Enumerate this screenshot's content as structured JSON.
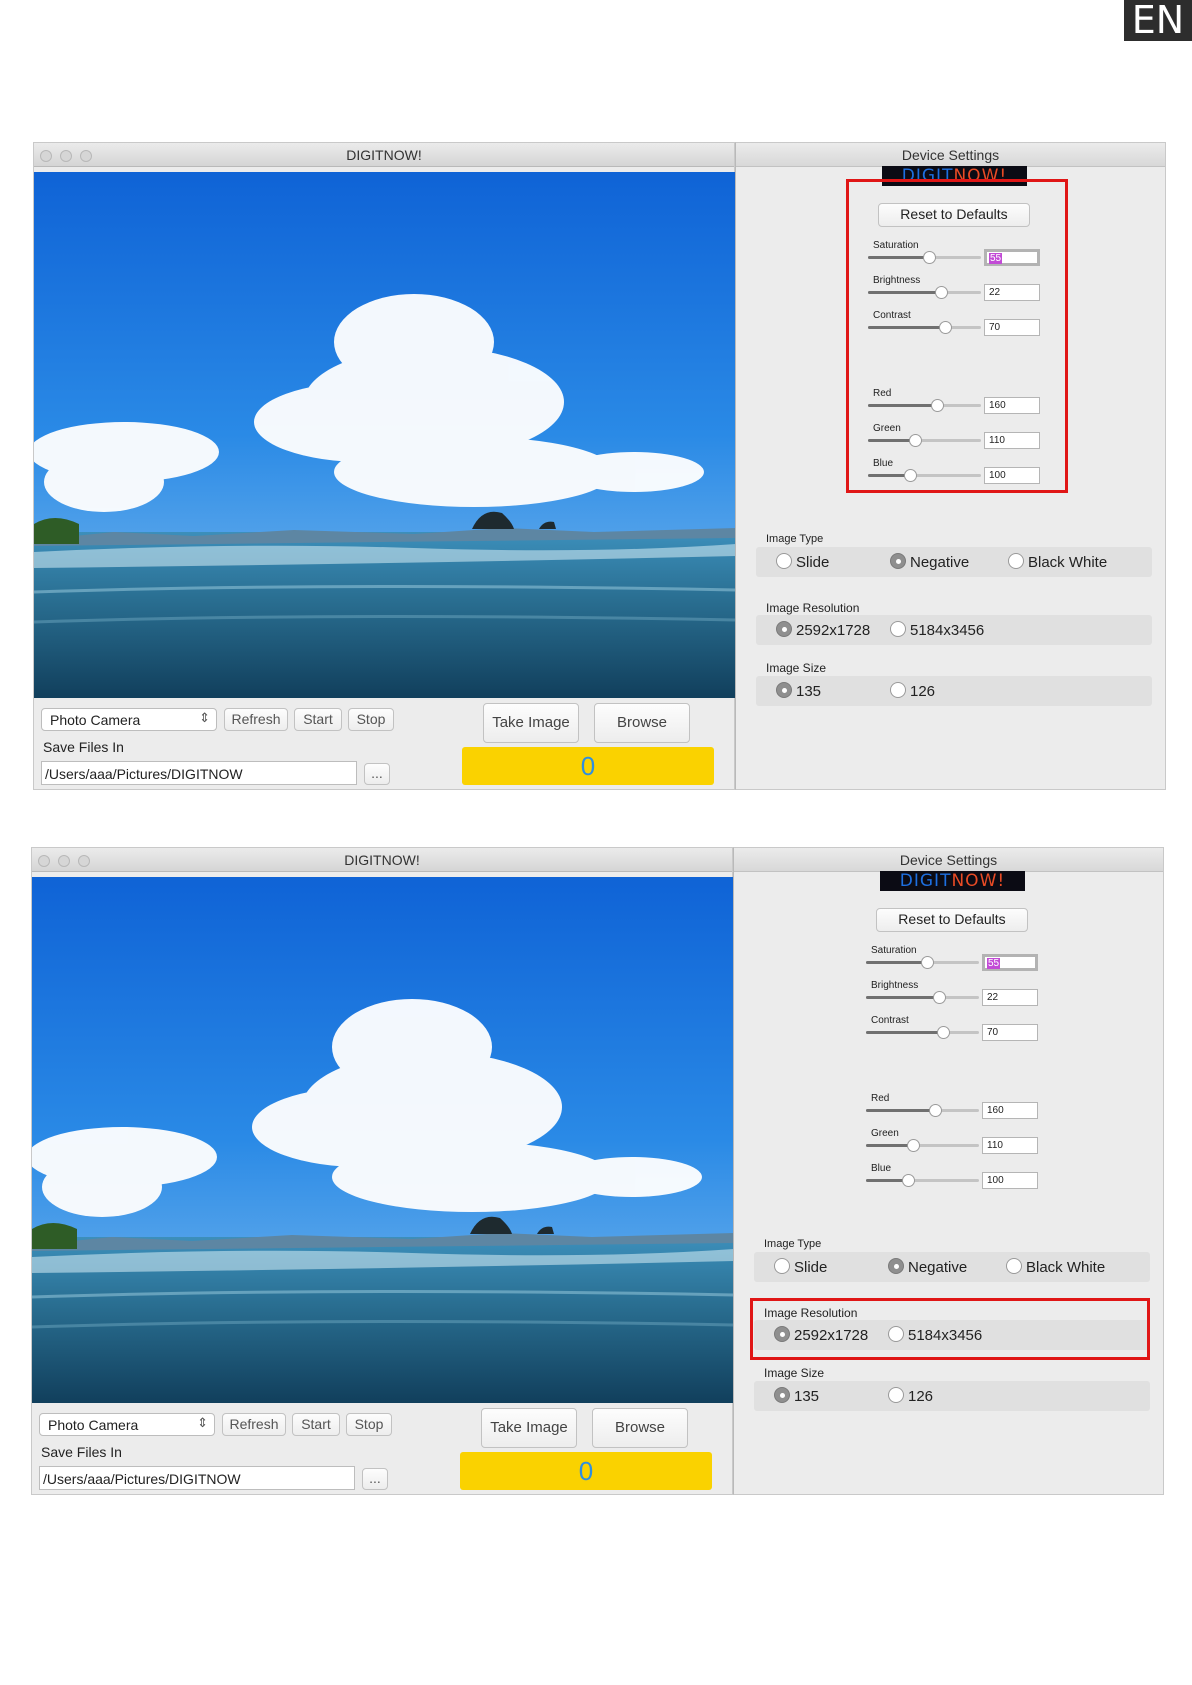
{
  "lang_badge": "EN",
  "window": {
    "title": "DIGITNOW!",
    "source_select": "Photo Camera",
    "buttons": {
      "refresh": "Refresh",
      "start": "Start",
      "stop": "Stop",
      "take_image": "Take Image",
      "browse": "Browse",
      "dots": "..."
    },
    "save_label": "Save Files In",
    "save_path": "/Users/aaa/Pictures/DIGITNOW",
    "counter": "0"
  },
  "settings": {
    "title": "Device Settings",
    "logo_part1": "DIGIT",
    "logo_part2": "NOW!",
    "reset_label": "Reset to Defaults",
    "sliders": [
      {
        "label": "Saturation",
        "value": "55",
        "fraction": 0.54
      },
      {
        "label": "Brightness",
        "value": "22",
        "fraction": 0.65
      },
      {
        "label": "Contrast",
        "value": "70",
        "fraction": 0.68
      },
      {
        "label": "Red",
        "value": "160",
        "fraction": 0.61
      },
      {
        "label": "Green",
        "value": "110",
        "fraction": 0.42
      },
      {
        "label": "Blue",
        "value": "100",
        "fraction": 0.37
      }
    ],
    "image_type": {
      "label": "Image Type",
      "options": [
        "Slide",
        "Negative",
        "Black White"
      ],
      "selected": "Negative"
    },
    "image_resolution": {
      "label": "Image Resolution",
      "options": [
        "2592x1728",
        "5184x3456"
      ],
      "selected": "2592x1728"
    },
    "image_size": {
      "label": "Image Size",
      "options": [
        "135",
        "126"
      ],
      "selected": "135"
    }
  },
  "colors": {
    "highlight_box": "#e01616",
    "counter_bg": "#fad200",
    "counter_text": "#2f8fe0"
  }
}
